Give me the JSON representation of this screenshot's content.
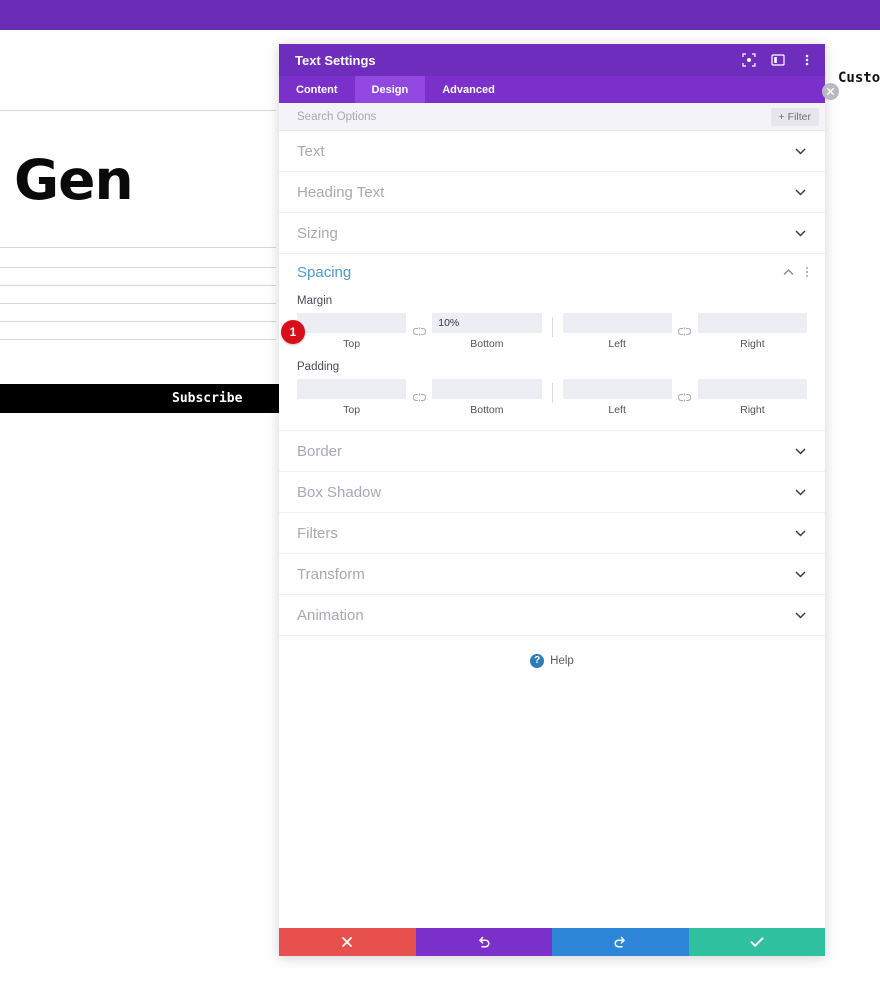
{
  "page_preview": {
    "brand_text": "Gen",
    "subscribe_button": "Subscribe",
    "custom_label": "Custom",
    "rules_y": [
      247,
      267,
      285,
      303,
      321,
      339
    ]
  },
  "modal": {
    "title": "Text Settings",
    "header_icons": [
      {
        "name": "reset-focus-icon",
        "glyph": "focus"
      },
      {
        "name": "panel-layout-icon",
        "glyph": "panel"
      },
      {
        "name": "more-options-icon",
        "glyph": "kebab"
      }
    ],
    "tabs": [
      {
        "label": "Content",
        "active": false
      },
      {
        "label": "Design",
        "active": true
      },
      {
        "label": "Advanced",
        "active": false
      }
    ],
    "search": {
      "placeholder": "Search Options",
      "value": "",
      "filter_label": "Filter",
      "filter_plus": "+"
    },
    "sections": [
      {
        "label": "Text",
        "state": "collapsed"
      },
      {
        "label": "Heading Text",
        "state": "collapsed"
      },
      {
        "label": "Sizing",
        "state": "collapsed"
      }
    ],
    "open_section": {
      "title": "Spacing",
      "groups": [
        {
          "label": "Margin",
          "fields": [
            {
              "sublabel": "Top",
              "value": ""
            },
            {
              "sublabel": "Bottom",
              "value": "10%"
            },
            {
              "sublabel": "Left",
              "value": ""
            },
            {
              "sublabel": "Right",
              "value": ""
            }
          ]
        },
        {
          "label": "Padding",
          "fields": [
            {
              "sublabel": "Top",
              "value": ""
            },
            {
              "sublabel": "Bottom",
              "value": ""
            },
            {
              "sublabel": "Left",
              "value": ""
            },
            {
              "sublabel": "Right",
              "value": ""
            }
          ]
        }
      ]
    },
    "sections_after": [
      {
        "label": "Border",
        "state": "collapsed"
      },
      {
        "label": "Box Shadow",
        "state": "collapsed"
      },
      {
        "label": "Filters",
        "state": "collapsed"
      },
      {
        "label": "Transform",
        "state": "collapsed"
      },
      {
        "label": "Animation",
        "state": "collapsed"
      }
    ],
    "help": {
      "badge": "?",
      "label": "Help"
    },
    "footer_buttons": [
      {
        "name": "discard-button",
        "icon": "close-icon",
        "color": "#e8504d"
      },
      {
        "name": "undo-button",
        "icon": "undo-icon",
        "color": "#7b30cc"
      },
      {
        "name": "redo-button",
        "icon": "redo-icon",
        "color": "#2e86d8"
      },
      {
        "name": "save-button",
        "icon": "check-icon",
        "color": "#2fc0a0"
      }
    ]
  },
  "annotations": {
    "marker_1": "1"
  },
  "colors": {
    "admin_bar": "#6a2bb5",
    "modal_header": "#6f2dbd",
    "tab_bar": "#7b30cc",
    "tab_active": "#9148e0",
    "section_open_title": "#4c9ad4",
    "marker": "#d80f18"
  }
}
